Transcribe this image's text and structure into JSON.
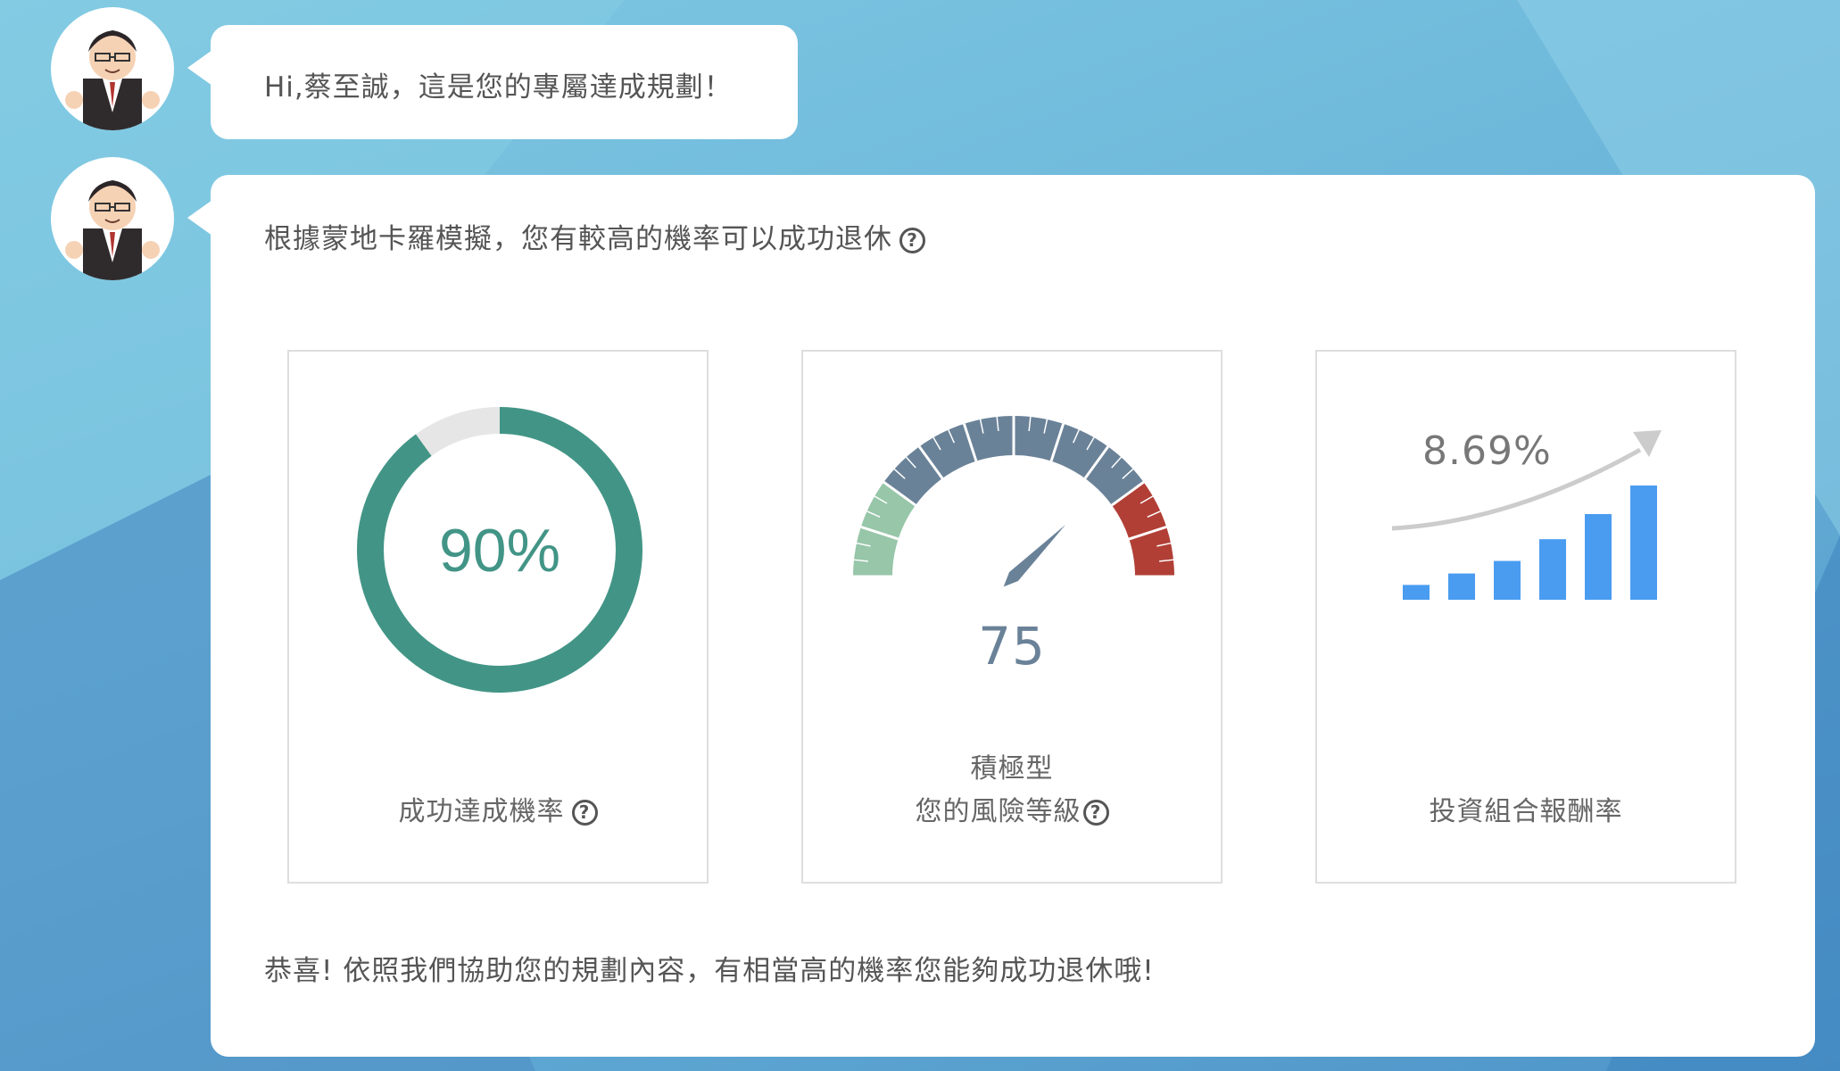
{
  "greeting": "Hi,蔡至誠，這是您的專屬達成規劃！",
  "intro": "根據蒙地卡羅模擬，您有較高的機率可以成功退休",
  "success_card": {
    "value": 0.9,
    "value_label": "90%",
    "label": "成功達成機率",
    "color": "#429586",
    "track_color": "#e6e6e6"
  },
  "risk_card": {
    "score": 75,
    "score_label": "75",
    "type": "積極型",
    "label": "您的風險等級",
    "colors": {
      "low": "#97c6a9",
      "mid": "#6a8298",
      "high": "#b13f36"
    }
  },
  "return_card": {
    "rate_label": "8.69%",
    "label": "投資組合報酬率",
    "bar_color": "#4a9cf0",
    "bar_levels": [
      0.13,
      0.23,
      0.34,
      0.53,
      0.75,
      1.0
    ]
  },
  "outro": "恭喜! 依照我們協助您的規劃內容，有相當高的機率您能夠成功退休哦!",
  "icons": {
    "avatar": "businessman-avatar",
    "help": "question-circle-icon",
    "gauge": "speedometer-icon",
    "trend": "trend-arrow-icon"
  }
}
